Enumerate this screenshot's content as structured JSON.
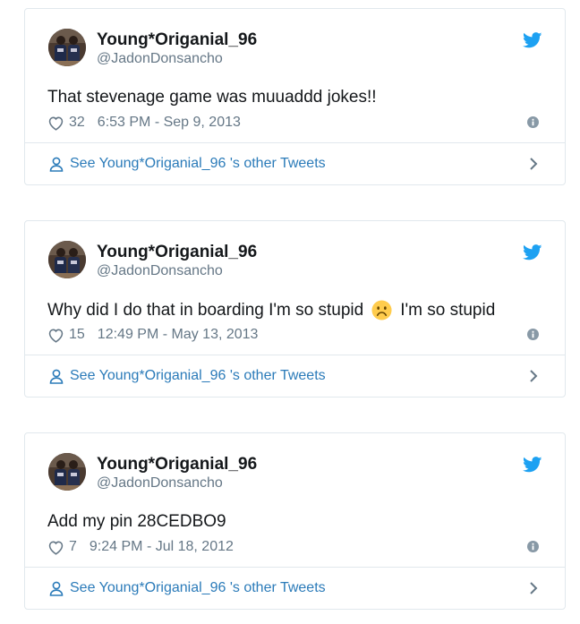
{
  "colors": {
    "name": "#14171a",
    "secondary": "#657786",
    "link": "#2b7bb9",
    "twitter_blue": "#1da1f2",
    "border": "#e1e8ed"
  },
  "tweets": [
    {
      "user_name": "Young*Origanial_96",
      "handle": "@JadonDonsancho",
      "text": "That stevenage game was muuaddd jokes!!",
      "text_after": "",
      "has_emoji": false,
      "likes": "32",
      "timestamp": "6:53 PM - Sep 9, 2013",
      "other_tweets_label": "See Young*Origanial_96 's other Tweets"
    },
    {
      "user_name": "Young*Origanial_96",
      "handle": "@JadonDonsancho",
      "text": "Why did I do that in boarding I'm so stupid",
      "text_after": "I'm so stupid",
      "has_emoji": true,
      "emoji_name": "frowning-face-emoji",
      "likes": "15",
      "timestamp": "12:49 PM - May 13, 2013",
      "other_tweets_label": "See Young*Origanial_96 's other Tweets"
    },
    {
      "user_name": "Young*Origanial_96",
      "handle": "@JadonDonsancho",
      "text": "Add my pin 28CEDBO9",
      "text_after": "",
      "has_emoji": false,
      "likes": "7",
      "timestamp": "9:24 PM - Jul 18, 2012",
      "other_tweets_label": "See Young*Origanial_96 's other Tweets"
    }
  ]
}
